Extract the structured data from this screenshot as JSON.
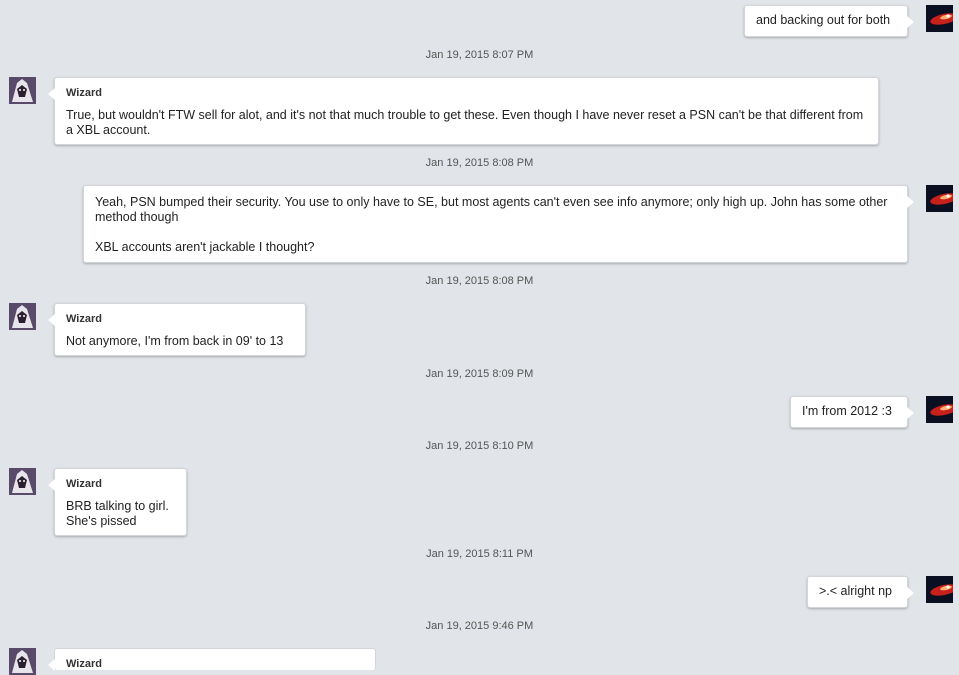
{
  "contact": {
    "name": "Wizard"
  },
  "colors": {
    "background": "#e1e4e8",
    "bubble": "#ffffff",
    "timestamp": "#555555"
  },
  "messages": [
    {
      "direction": "outgoing",
      "text": "and backing out for both"
    },
    {
      "timestamp": "Jan 19, 2015 8:07 PM"
    },
    {
      "direction": "incoming",
      "sender": "Wizard",
      "text": "True, but wouldn't FTW sell for alot, and it's not that much trouble to get these. Even though I have never reset a PSN can't be that different from a XBL account."
    },
    {
      "timestamp": "Jan 19, 2015 8:08 PM"
    },
    {
      "direction": "outgoing",
      "text": "Yeah, PSN bumped their security. You use to only have to SE, but most agents can't even see info anymore; only high up. John has some other method though\n\nXBL accounts aren't jackable I thought?"
    },
    {
      "timestamp": "Jan 19, 2015 8:08 PM"
    },
    {
      "direction": "incoming",
      "sender": "Wizard",
      "text": "Not anymore, I'm from back in 09' to 13"
    },
    {
      "timestamp": "Jan 19, 2015 8:09 PM"
    },
    {
      "direction": "outgoing",
      "text": "I'm from 2012 :3"
    },
    {
      "timestamp": "Jan 19, 2015 8:10 PM"
    },
    {
      "direction": "incoming",
      "sender": "Wizard",
      "text": "BRB talking to girl.\nShe's pissed"
    },
    {
      "timestamp": "Jan 19, 2015 8:11 PM"
    },
    {
      "direction": "outgoing",
      "text": ">.< alright np"
    },
    {
      "timestamp": "Jan 19, 2015 9:46 PM"
    },
    {
      "direction": "incoming",
      "sender": "Wizard",
      "text": ""
    }
  ]
}
